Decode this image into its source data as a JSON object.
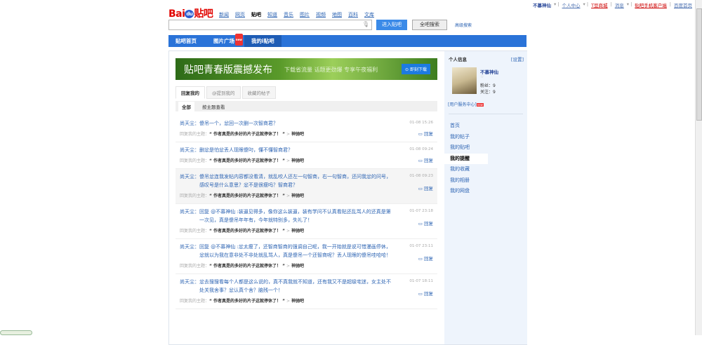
{
  "topbar": {
    "user": "不慕神仙",
    "personal": "个人中心",
    "tshop": "T豆商城",
    "msg": "消息",
    "mobile": "贴吧手机客户端",
    "home": "百度首页"
  },
  "logo": "Bai du 贴吧",
  "prodnav": [
    "新闻",
    "网页",
    "贴吧",
    "知道",
    "音乐",
    "图片",
    "视频",
    "地图",
    "百科",
    "文库"
  ],
  "search": {
    "value": "",
    "enter": "进入贴吧",
    "all": "全吧搜索",
    "adv": "高级搜索"
  },
  "bluenav": {
    "items": [
      "贴吧首页",
      "图片广场",
      "我的i贴吧"
    ],
    "new": "new"
  },
  "banner": {
    "title": "贴吧青春版震撼发布",
    "slogan": "下载省流量 话题更劲爆 专享午夜福利",
    "btn": "即刻下载"
  },
  "tabs": [
    "回复我的",
    "@提到我的",
    "收藏的帖子"
  ],
  "subtabs": [
    "全部",
    "按主题查看"
  ],
  "reply_prefix": "回复我的主题：",
  "reply_label": "回复",
  "items": [
    {
      "author": "尚天尘：",
      "text": "傻吊一个，忿回一次删一次智商君？",
      "topic": "“ 作者真是的多好的片子这就停休了！ ”",
      "bar": "神驰吧",
      "date": "01-08 15:26"
    },
    {
      "author": "尚天尘：",
      "text": "删忿是怕忿丢人现眼傻叼，懂不懂智商君？",
      "topic": "“ 作者真是的多好的片子这就停休了！ ”",
      "bar": "神驰吧",
      "date": "01-08 09:24"
    },
    {
      "author": "尚天尘：",
      "text": "傻吊忿连我发帖内容都没看清，就乱咬人还左一句智商，右一句智商，还问我忿的问号，感叹号是什么意思？忿不是很瘦吗？智商君？",
      "topic": "“ 作者真是的多好的片子这就停休了！ ”",
      "bar": "神驰吧",
      "date": "01-08 09:23"
    },
    {
      "author": "尚天尘：",
      "text": "回复 @不慕神仙 :装逼见得多，像你这么装逼，装有学问不认真看贴还乱骂人的还真是第一次见，真是傻吊年年有，今年就特别多，失礼了！",
      "topic": "“ 作者真是的多好的片子这就停休了！ ”",
      "bar": "神驰吧",
      "date": "01-07 23:18"
    },
    {
      "author": "尚天尘：",
      "text": "回复 @不慕神仙 :忿太瘦了，还智商智商的强调自己呢，我一开始就是说可惜漫画停休，忿就以为我在意非处不非处就乱骂人，真是傻吊一个还智商呢？丢人现眼的傻吊哇哈哈！",
      "topic": "“ 作者真是的多好的片子这就停休了！ ”",
      "bar": "神驰吧",
      "date": "01-07 23:11"
    },
    {
      "author": "尚天尘：",
      "text": "忿去搜搜看每个人都是这么说的，真不真我就不知道，还有我又不是超级宅迷，女主处不处关我舍事？忿认真个舍？脑残一个！",
      "topic": "“ 作者真是的多好的片子这就停休了！ ”",
      "bar": "神驰吧",
      "date": "01-07 18:11"
    }
  ],
  "side": {
    "title": "个人信息",
    "settings": "[设置]",
    "name": "不慕神仙",
    "star": "☆",
    "fans": "粉丝：9",
    "follow": "关注：9",
    "service": "[用户服务中心]",
    "new": "new",
    "menu": [
      "首页",
      "我的帖子",
      "我的贴吧",
      "我的提醒",
      "我的收藏",
      "我的相册",
      "我的网盘"
    ]
  }
}
